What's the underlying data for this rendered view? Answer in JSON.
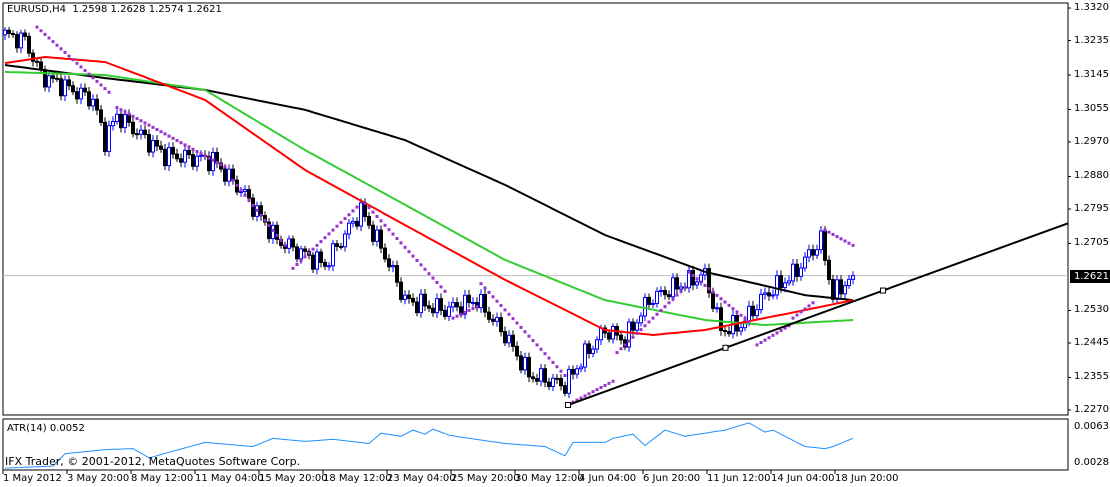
{
  "header": {
    "symbol": "EURUSD,H4",
    "ohlc": "1.2598 1.2628 1.2574 1.2621"
  },
  "atr_label": "ATR(14) 0.0052",
  "copyright": "IFX Trader, © 2001-2012, MetaQuotes Software Corp.",
  "current_price": "1.2621",
  "colors": {
    "bull": "#0000ff",
    "bear": "#000000",
    "ma_red": "#ff0000",
    "ma_green": "#33cc33",
    "ma_black": "#000000",
    "sar": "#9933cc",
    "atr": "#1e90ff"
  },
  "chart_data": {
    "type": "candlestick",
    "title": "EURUSD,H4",
    "ylim": [
      1.227,
      1.332
    ],
    "y_ticks": [
      "1.3320",
      "1.3235",
      "1.3145",
      "1.3055",
      "1.2970",
      "1.2880",
      "1.2795",
      "1.2705",
      "1.2621",
      "1.2530",
      "1.2445",
      "1.2355",
      "1.2270"
    ],
    "x_ticks": [
      "1 May 2012",
      "3 May 20:00",
      "8 May 12:00",
      "11 May 04:00",
      "15 May 20:00",
      "18 May 12:00",
      "23 May 04:00",
      "25 May 20:00",
      "30 May 12:00",
      "4 Jun 04:00",
      "6 Jun 20:00",
      "11 Jun 12:00",
      "14 Jun 04:00",
      "18 Jun 20:00"
    ],
    "bar_count": 213,
    "close_waypoints": [
      [
        0,
        1.325
      ],
      [
        5,
        1.3236
      ],
      [
        9,
        1.3145
      ],
      [
        22,
        1.308
      ],
      [
        25,
        1.2975
      ],
      [
        28,
        1.304
      ],
      [
        40,
        1.2936
      ],
      [
        52,
        1.2923
      ],
      [
        60,
        1.2832
      ],
      [
        68,
        1.2714
      ],
      [
        80,
        1.2649
      ],
      [
        89,
        1.2792
      ],
      [
        95,
        1.2675
      ],
      [
        100,
        1.2557
      ],
      [
        110,
        1.2531
      ],
      [
        118,
        1.2557
      ],
      [
        125,
        1.2466
      ],
      [
        131,
        1.2362
      ],
      [
        140,
        1.2335
      ],
      [
        145,
        1.2414
      ],
      [
        150,
        1.2479
      ],
      [
        155,
        1.2453
      ],
      [
        161,
        1.2557
      ],
      [
        166,
        1.2584
      ],
      [
        175,
        1.2623
      ],
      [
        179,
        1.2479
      ],
      [
        184,
        1.2492
      ],
      [
        190,
        1.257
      ],
      [
        197,
        1.2623
      ],
      [
        204,
        1.2714
      ],
      [
        207,
        1.257
      ],
      [
        212,
        1.2621
      ]
    ],
    "ma_red": [
      [
        0,
        1.3176
      ],
      [
        10,
        1.3192
      ],
      [
        25,
        1.3179
      ],
      [
        50,
        1.308
      ],
      [
        75,
        1.2897
      ],
      [
        100,
        1.2753
      ],
      [
        125,
        1.261
      ],
      [
        150,
        1.2479
      ],
      [
        162,
        1.2466
      ],
      [
        175,
        1.2479
      ],
      [
        200,
        1.2531
      ],
      [
        212,
        1.2557
      ]
    ],
    "ma_green": [
      [
        0,
        1.3153
      ],
      [
        25,
        1.3145
      ],
      [
        50,
        1.3106
      ],
      [
        75,
        1.2949
      ],
      [
        100,
        1.2806
      ],
      [
        125,
        1.2662
      ],
      [
        150,
        1.2557
      ],
      [
        175,
        1.2505
      ],
      [
        190,
        1.2492
      ],
      [
        212,
        1.2505
      ]
    ],
    "ma_black": [
      [
        0,
        1.3171
      ],
      [
        25,
        1.3137
      ],
      [
        50,
        1.3106
      ],
      [
        75,
        1.3054
      ],
      [
        100,
        1.2975
      ],
      [
        125,
        1.2858
      ],
      [
        150,
        1.2727
      ],
      [
        175,
        1.2631
      ],
      [
        200,
        1.257
      ],
      [
        212,
        1.2557
      ]
    ],
    "sar_segments": [
      [
        8,
        26,
        1.327,
        1.31
      ],
      [
        28,
        55,
        1.306,
        1.2905
      ],
      [
        57,
        70,
        1.287,
        1.27
      ],
      [
        72,
        88,
        1.264,
        1.28
      ],
      [
        90,
        110,
        1.281,
        1.258
      ],
      [
        112,
        118,
        1.251,
        1.254
      ],
      [
        119,
        140,
        1.26,
        1.236
      ],
      [
        141,
        152,
        1.2285,
        1.2345
      ],
      [
        153,
        170,
        1.242,
        1.259
      ],
      [
        171,
        186,
        1.263,
        1.25
      ],
      [
        188,
        196,
        1.244,
        1.249
      ],
      [
        197,
        202,
        1.251,
        1.255
      ],
      [
        205,
        212,
        1.274,
        1.27
      ]
    ],
    "trendline": [
      [
        140.75,
        1.2283
      ],
      [
        219.5,
        1.2582
      ]
    ],
    "atr": {
      "ylim": [
        0.0028,
        0.0063
      ],
      "ticks": [
        "0.0063",
        "0.0028"
      ],
      "waypoints": [
        [
          0,
          0.0023
        ],
        [
          12,
          0.0025
        ],
        [
          15,
          0.0037
        ],
        [
          25,
          0.0041
        ],
        [
          32,
          0.0042
        ],
        [
          36,
          0.0033
        ],
        [
          50,
          0.0048
        ],
        [
          62,
          0.0044
        ],
        [
          67,
          0.0052
        ],
        [
          75,
          0.0049
        ],
        [
          82,
          0.0051
        ],
        [
          91,
          0.0047
        ],
        [
          94,
          0.0057
        ],
        [
          99,
          0.0054
        ],
        [
          102,
          0.006
        ],
        [
          105,
          0.0056
        ],
        [
          107,
          0.0061
        ],
        [
          111,
          0.0055
        ],
        [
          116,
          0.0052
        ],
        [
          125,
          0.0047
        ],
        [
          135,
          0.0044
        ],
        [
          140,
          0.0035
        ],
        [
          142,
          0.0048
        ],
        [
          150,
          0.0048
        ],
        [
          152,
          0.0052
        ],
        [
          157,
          0.0056
        ],
        [
          160,
          0.0045
        ],
        [
          165,
          0.006
        ],
        [
          170,
          0.0054
        ],
        [
          175,
          0.0057
        ],
        [
          180,
          0.006
        ],
        [
          186,
          0.0067
        ],
        [
          190,
          0.0058
        ],
        [
          192,
          0.006
        ],
        [
          200,
          0.0044
        ],
        [
          205,
          0.0042
        ],
        [
          207,
          0.0044
        ],
        [
          212,
          0.0052
        ]
      ]
    }
  }
}
